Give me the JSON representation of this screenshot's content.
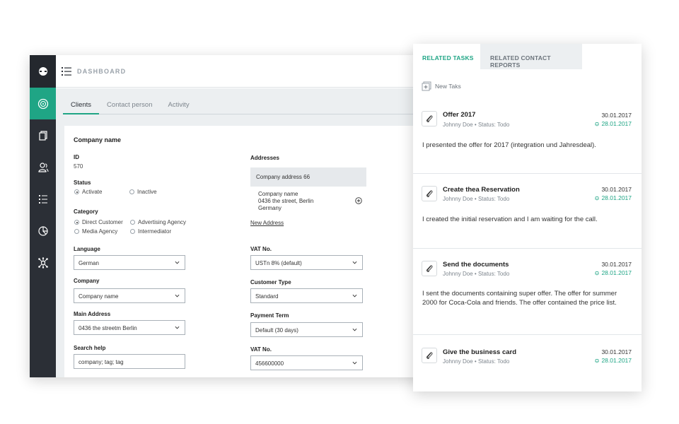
{
  "window": {
    "title": "DASHBOARD",
    "tabs": [
      "Clients",
      "Contact person",
      "Activity"
    ],
    "accent": "#1fa585",
    "sidebar_icons": [
      "logo-icon",
      "palette-icon",
      "documents-icon",
      "users-icon",
      "list-icon",
      "pie-chart-icon",
      "network-icon"
    ]
  },
  "form": {
    "card_title": "Company name",
    "id_label": "ID",
    "id_value": "570",
    "status_label": "Status",
    "status_options": [
      "Activate",
      "Inactive"
    ],
    "status_selected": "Activate",
    "category_label": "Category",
    "category_options": [
      "Direct Customer",
      "Advertising Agency",
      "Media Agency",
      "Intermediator"
    ],
    "category_selected": "Direct Customer",
    "language_label": "Language",
    "language_value": "German",
    "company_label": "Company",
    "company_value": "Company name",
    "main_address_label": "Main Address",
    "main_address_value": "0436 the streetm Berlin",
    "search_help_label": "Search help",
    "search_help_value": "company; tag; tag",
    "addresses_label": "Addresses",
    "address_head": "Company address 66",
    "address_lines": [
      "Company name",
      "0436 the street, Berlin",
      "Germany"
    ],
    "new_address": "New Address",
    "vat_label": "VAT No.",
    "vat_value": "USTn 8% (default)",
    "customer_type_label": "Customer Type",
    "customer_type_value": "Standard",
    "payment_term_label": "Payment Term",
    "payment_term_value": "Default (30 days)",
    "vat2_label": "VAT No.",
    "vat2_value": "456600000"
  },
  "panel": {
    "tabs": [
      "RELATED TASKS",
      "RELATED CONTACT REPORTS"
    ],
    "new_task": "New Taks",
    "tasks": [
      {
        "title": "Offer 2017",
        "sub": "Johnny Doe • Status: Todo",
        "date": "30.01.2017",
        "due": "28.01.2017",
        "body": "I presented the offer for 2017 (integration und Jahresdeal)."
      },
      {
        "title": "Create thea Reservation",
        "sub": "Johnny Doe • Status: Todo",
        "date": "30.01.2017",
        "due": "28.01.2017",
        "body": "I created the initial reservation and I am waiting for the call."
      },
      {
        "title": "Send the documents",
        "sub": "Johnny Doe • Status: Todo",
        "date": "30.01.2017",
        "due": "28.01.2017",
        "body": "I sent the documents containing super offer. The offer for summer 2000 for Coca-Cola and friends. The offer contained the price list."
      },
      {
        "title": "Give the business card",
        "sub": "Johnny Doe • Status: Todo",
        "date": "30.01.2017",
        "due": "28.01.2017",
        "body": ""
      }
    ]
  }
}
